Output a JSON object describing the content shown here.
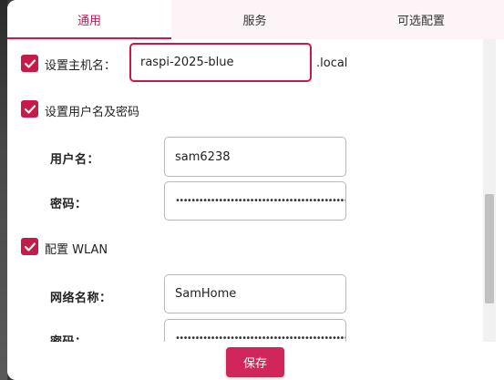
{
  "tabs": [
    {
      "label": "通用",
      "active": true
    },
    {
      "label": "服务",
      "active": false
    },
    {
      "label": "可选配置",
      "active": false
    }
  ],
  "hostname": {
    "checked": true,
    "label": "设置主机名：",
    "value": "raspi-2025-blue",
    "suffix": ".local"
  },
  "user": {
    "checked": true,
    "label": "设置用户名及密码",
    "username_label": "用户名：",
    "username_value": "sam6238",
    "password_label": "密码：",
    "password_value": "••••••••••••••••••••••••••••••••••••••••••••"
  },
  "wlan": {
    "checked": true,
    "label": "配置 WLAN",
    "ssid_label": "网络名称：",
    "ssid_value": "SamHome",
    "password_label": "密码：",
    "password_value": "••••••••••••••••••••••••••••••••••••••••••••"
  },
  "footer": {
    "save_label": "保存"
  },
  "colors": {
    "accent": "#c51a4a",
    "button": "#d0265b"
  }
}
